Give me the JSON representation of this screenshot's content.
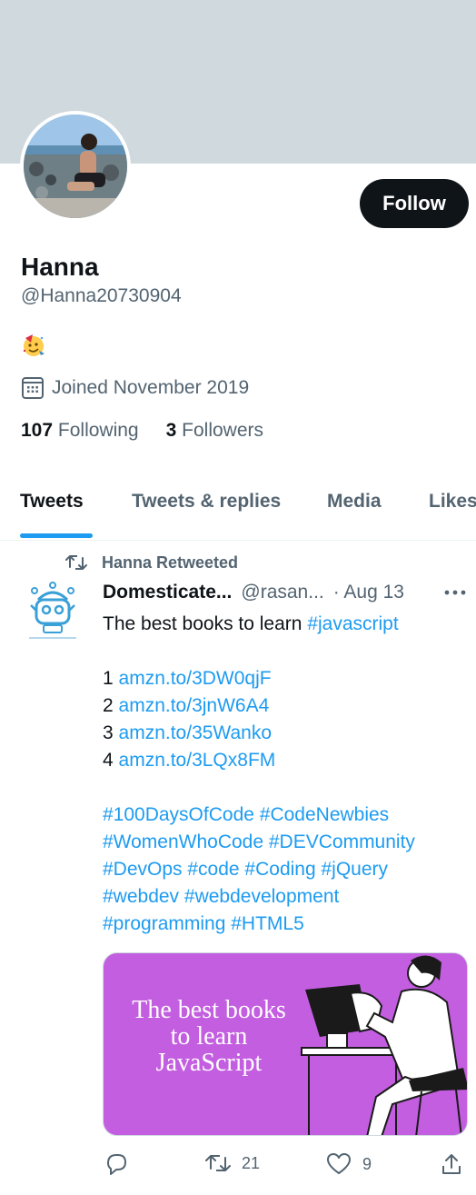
{
  "profile": {
    "name": "Hanna",
    "handle": "@Hanna20730904",
    "joined": "Joined November 2019",
    "following_count": "107",
    "following_label": "Following",
    "followers_count": "3",
    "followers_label": "Followers",
    "follow_button": "Follow"
  },
  "tabs": [
    {
      "label": "Tweets",
      "active": true
    },
    {
      "label": "Tweets & replies",
      "active": false
    },
    {
      "label": "Media",
      "active": false
    },
    {
      "label": "Likes",
      "active": false
    }
  ],
  "tweet": {
    "retweet_label": "Hanna Retweeted",
    "author": "Domesticate...",
    "handle": "@rasan...",
    "date": "· Aug 13",
    "text_intro": "The best books to learn ",
    "text_hashtag": "#javascript",
    "books": [
      {
        "num": "1",
        "link": "amzn.to/3DW0qjF"
      },
      {
        "num": "2",
        "link": "amzn.to/3jnW6A4"
      },
      {
        "num": "3",
        "link": "amzn.to/35Wanko"
      },
      {
        "num": "4",
        "link": "amzn.to/3LQx8FM"
      }
    ],
    "hashtag_lines": [
      "#100DaysOfCode #CodeNewbies",
      "#WomenWhoCode #DEVCommunity",
      "#DevOps #code #Coding #jQuery",
      "#webdev #webdevelopment",
      "#programming #HTML5"
    ],
    "media_title": "The best books to learn JavaScript",
    "retweets": "21",
    "likes": "9"
  },
  "colors": {
    "accent": "#1d9bf0",
    "banner": "#cfd9de",
    "media_bg": "#c35ee0"
  }
}
